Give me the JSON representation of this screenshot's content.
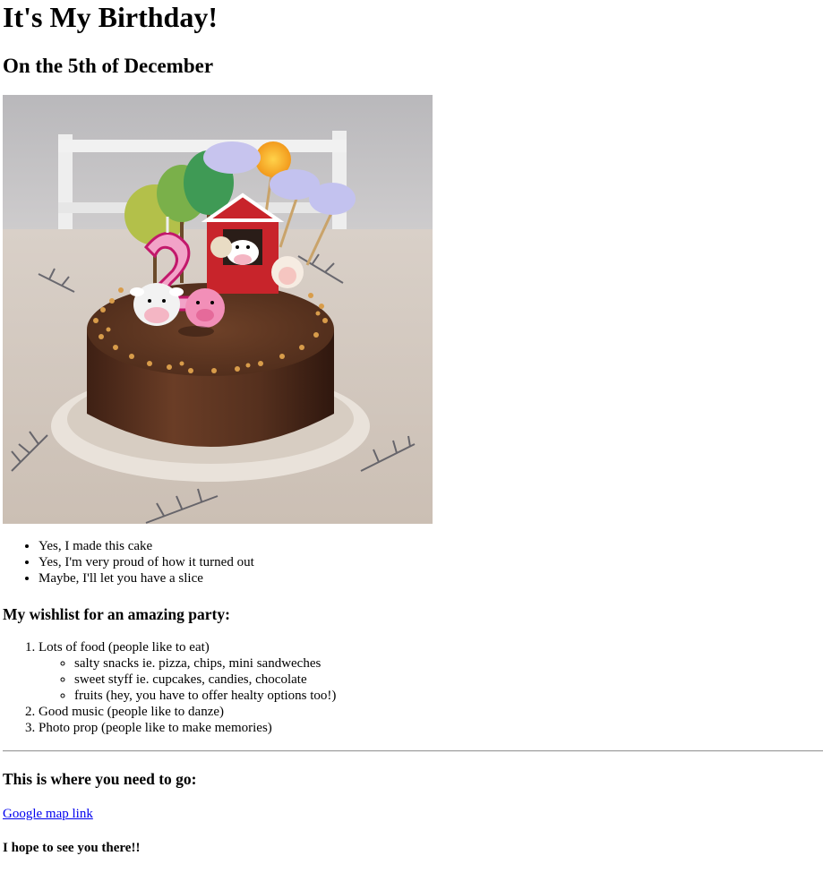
{
  "header": {
    "title": "It's My Birthday!",
    "subtitle": "On the 5th of December"
  },
  "photo": {
    "alt": "Chocolate birthday cake with farm animal toppers and a number 2 candle"
  },
  "facts": [
    "Yes, I made this cake",
    "Yes, I'm very proud of how it turned out",
    "Maybe, I'll let you have a slice"
  ],
  "wishlist": {
    "heading": "My wishlist for an amazing party:",
    "items": [
      {
        "label": "Lots of food (people like to eat)",
        "sub": [
          "salty snacks ie. pizza, chips, mini sandweches",
          "sweet styff ie. cupcakes, candies, chocolate",
          "fruits (hey, you have to offer healty options too!)"
        ]
      },
      {
        "label": "Good music (people like to danze)"
      },
      {
        "label": "Photo prop (people like to make memories)"
      }
    ]
  },
  "location": {
    "heading": "This is where you need to go:",
    "link_label": "Google map link"
  },
  "closing": "I hope to see you there!!",
  "colors": {
    "link": "#0000ee",
    "chocolate": "#5a3220",
    "barn_red": "#c8242b"
  }
}
